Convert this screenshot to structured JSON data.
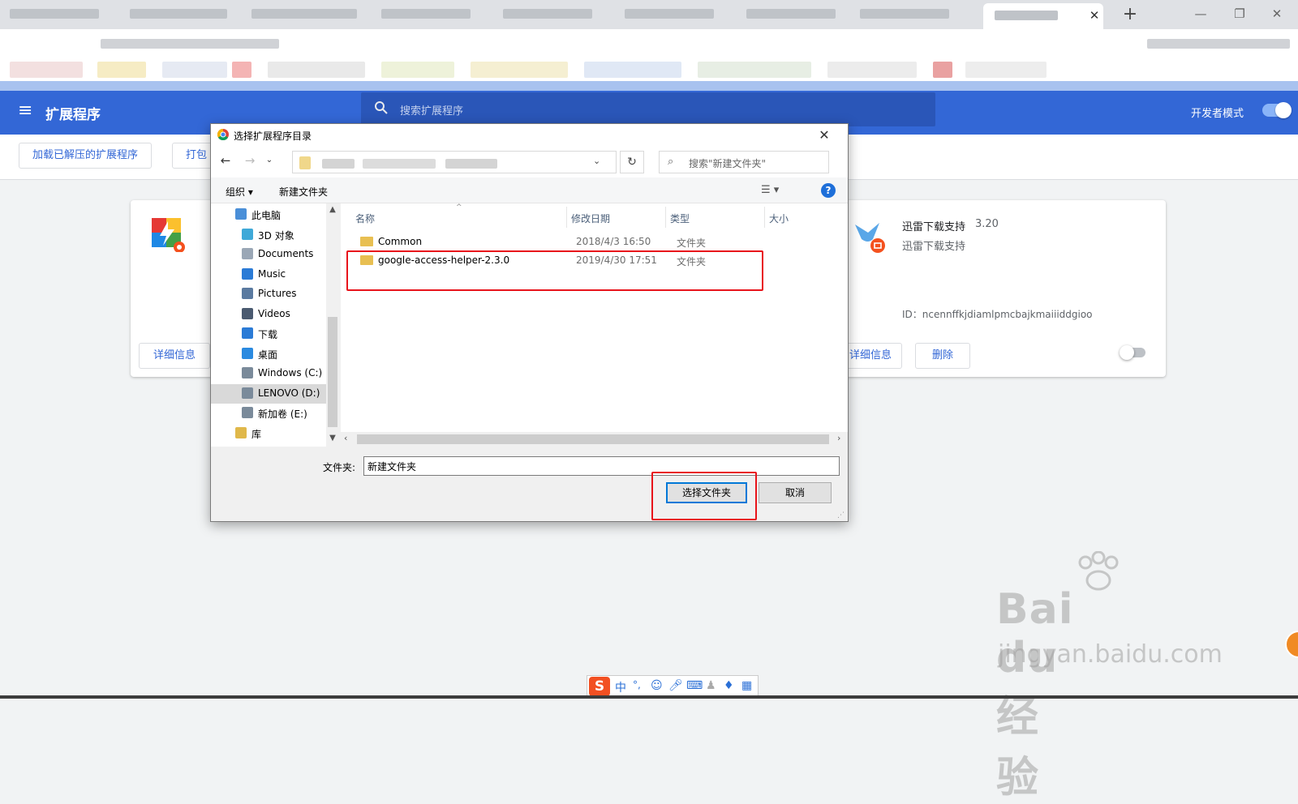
{
  "extensions_page": {
    "title": "扩展程序",
    "search_placeholder": "搜索扩展程序",
    "dev_mode_label": "开发者模式",
    "dev_mode_on": true,
    "load_unpacked_label": "加载已解压的扩展程序",
    "pack_label": "打包",
    "card1": {
      "details_label": "详细信息"
    },
    "card2": {
      "name": "迅雷下载支持",
      "version": "3.20",
      "description": "迅雷下载支持",
      "id": "ID：ncennffkjdiamlpmcbajkmaiiiddgioo",
      "details_label": "详细信息",
      "remove_label": "删除",
      "enabled": false
    }
  },
  "dialog": {
    "title": "选择扩展程序目录",
    "search_placeholder": "搜索\"新建文件夹\"",
    "organize_label": "组织 ▾",
    "new_folder_label": "新建文件夹",
    "nav_items": [
      {
        "label": "此电脑",
        "icon": "computer-icon"
      },
      {
        "label": "3D 对象",
        "icon": "3d-objects-icon"
      },
      {
        "label": "Documents",
        "icon": "documents-icon"
      },
      {
        "label": "Music",
        "icon": "music-icon"
      },
      {
        "label": "Pictures",
        "icon": "pictures-icon"
      },
      {
        "label": "Videos",
        "icon": "videos-icon"
      },
      {
        "label": "下载",
        "icon": "download-icon"
      },
      {
        "label": "桌面",
        "icon": "desktop-icon"
      },
      {
        "label": "Windows (C:)",
        "icon": "drive-icon"
      },
      {
        "label": "LENOVO (D:)",
        "icon": "drive-icon",
        "selected": true
      },
      {
        "label": "新加卷 (E:)",
        "icon": "drive-icon"
      },
      {
        "label": "库",
        "icon": "library-icon"
      }
    ],
    "columns": {
      "name": "名称",
      "date": "修改日期",
      "type": "类型",
      "size": "大小"
    },
    "files": [
      {
        "name": "Common",
        "date": "2018/4/3 16:50",
        "type": "文件夹"
      },
      {
        "name": "google-access-helper-2.3.0",
        "date": "2019/4/30 17:51",
        "type": "文件夹"
      }
    ],
    "folder_label": "文件夹:",
    "folder_value": "新建文件夹",
    "select_button": "选择文件夹",
    "cancel_button": "取消"
  },
  "ime": {
    "chinese_mode": "中",
    "punct": "°,"
  },
  "watermark": {
    "brand": "Bai du 经验",
    "url": "jingyan.baidu.com"
  },
  "colors": {
    "accent": "#3367d6",
    "highlight": "#e8141b"
  }
}
